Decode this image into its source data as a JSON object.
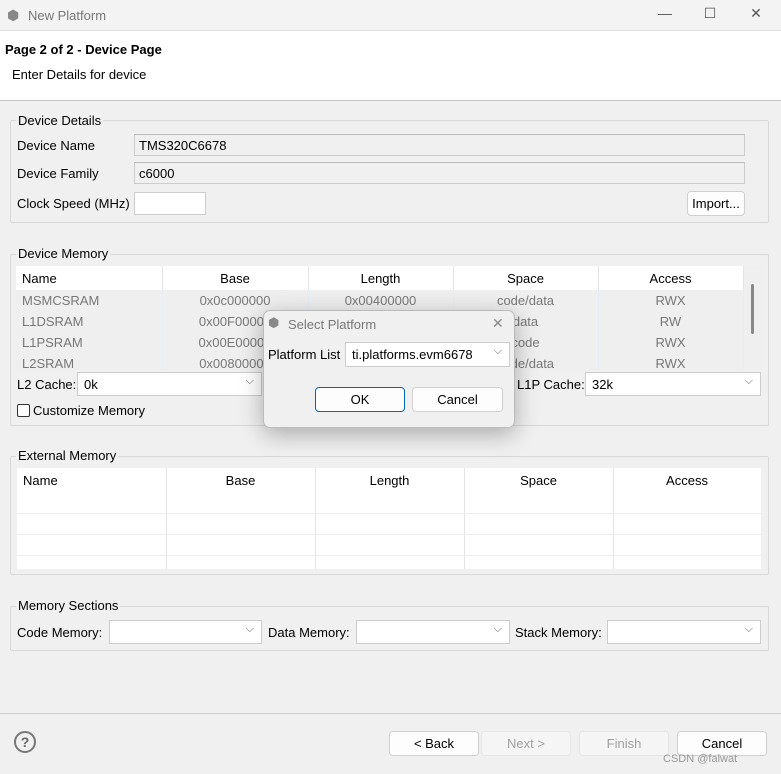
{
  "window": {
    "title": "New Platform",
    "icon": "cube-icon"
  },
  "header": {
    "title": "Page 2 of 2 - Device Page",
    "subtitle": "Enter Details for device"
  },
  "device_details": {
    "label": "Device Details",
    "name_label": "Device Name",
    "name_value": "TMS320C6678",
    "family_label": "Device Family",
    "family_value": "c6000",
    "clock_label": "Clock Speed (MHz)",
    "clock_value": "",
    "import_label": "Import..."
  },
  "device_memory": {
    "label": "Device Memory",
    "columns": [
      "Name",
      "Base",
      "Length",
      "Space",
      "Access"
    ],
    "rows": [
      [
        "MSMCSRAM",
        "0x0c000000",
        "0x00400000",
        "code/data",
        "RWX"
      ],
      [
        "L1DSRAM",
        "0x00F00000",
        "",
        "data",
        "RW"
      ],
      [
        "L1PSRAM",
        "0x00E00000",
        "",
        "code",
        "RWX"
      ],
      [
        "L2SRAM",
        "0x00800000",
        "",
        "code/data",
        "RWX"
      ]
    ],
    "l2_label": "L2 Cache:",
    "l2_value": "0k",
    "l1p_label": "L1P Cache:",
    "l1p_value": "32k",
    "customize_label": "Customize Memory",
    "customize_checked": false
  },
  "external_memory": {
    "label": "External Memory",
    "columns": [
      "Name",
      "Base",
      "Length",
      "Space",
      "Access"
    ]
  },
  "memory_sections": {
    "label": "Memory Sections",
    "code_label": "Code Memory:",
    "code_value": "",
    "data_label": "Data Memory:",
    "data_value": "",
    "stack_label": "Stack Memory:",
    "stack_value": ""
  },
  "footer": {
    "back": "< Back",
    "next": "Next >",
    "finish": "Finish",
    "cancel": "Cancel",
    "help_icon": "help-icon"
  },
  "dialog": {
    "title": "Select Platform",
    "list_label": "Platform List",
    "list_value": "ti.platforms.evm6678",
    "ok": "OK",
    "cancel": "Cancel"
  },
  "watermark": "CSDN @falwat"
}
